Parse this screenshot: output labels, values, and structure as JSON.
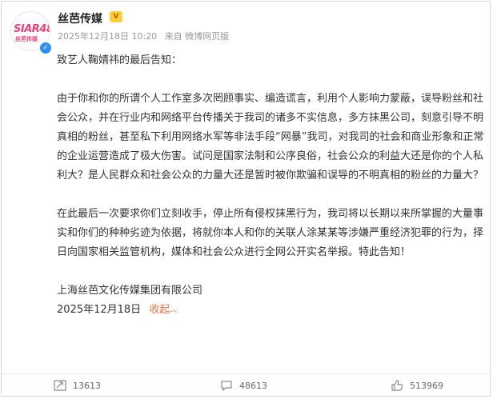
{
  "account": {
    "name": "丝芭传媒",
    "avatar_logo": "SIAR48",
    "avatar_sub": "丝芭传媒"
  },
  "post": {
    "date": "2025年12月18日 10:20",
    "source": "来自 微博网页版",
    "greeting": "致艺人鞠婧祎的最后告知：",
    "paragraph1": "由于你和你的所谓个人工作室多次罔顾事实、编造谎言，利用个人影响力蒙蔽，误导粉丝和社会公众，并在行业内和网络平台传播关于我司的诸多不实信息，多方抹黑公司，刻意引导不明真相的粉丝，甚至私下利用网络水军等非法手段“网暴”我司，对我司的社会和商业形象和正常的企业运营造成了极大伤害。试问是国家法制和公序良俗，社会公众的利益大还是你的个人私利大？是人民群众和社会公众的力量大还是暂时被你欺骗和误导的不明真相的粉丝的力量大？",
    "paragraph2": "在此最后一次要求你们立刻收手，停止所有侵权抹黑行为，我司将以长期以来所掌握的大量事实和你们的种种劣迹为依据，将就你本人和你的关联人涂某某等涉嫌严重经济犯罪的行为，择日向国家相关监管机构，媒体和社会公众进行全网公开实名举报。特此告知！",
    "signature": "上海丝芭文化传媒集团有限公司",
    "sign_date": "2025年12月18日",
    "collapse_label": "收起"
  },
  "actions": {
    "reposts": "13613",
    "comments": "48613",
    "likes": "513969"
  },
  "colors": {
    "accent_orange": "#eb7340",
    "verified_blue": "#2e8ff0",
    "brand_pink": "#e8427e"
  }
}
